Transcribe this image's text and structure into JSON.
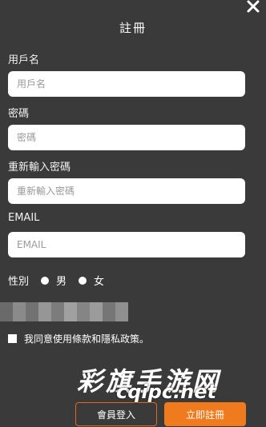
{
  "dialog": {
    "title": "註冊",
    "close_icon": "close-icon"
  },
  "form": {
    "username": {
      "label": "用戶名",
      "placeholder": "用戶名",
      "value": ""
    },
    "password": {
      "label": "密碼",
      "placeholder": "密碼",
      "value": ""
    },
    "confirm_password": {
      "label": "重新輸入密碼",
      "placeholder": "重新輸入密碼",
      "value": ""
    },
    "email": {
      "label": "EMAIL",
      "placeholder": "EMAIL",
      "value": ""
    },
    "gender": {
      "label": "性別",
      "options": [
        "男",
        "女"
      ]
    },
    "agree": {
      "text": "我同意使用條款和隱私政策。"
    }
  },
  "buttons": {
    "login": "會員登入",
    "register": "立即註冊"
  },
  "watermark": {
    "title": "彩旗手游网",
    "url": "cqipc.net"
  },
  "colors": {
    "background": "#3a3a3a",
    "accent": "#f07a1e"
  }
}
